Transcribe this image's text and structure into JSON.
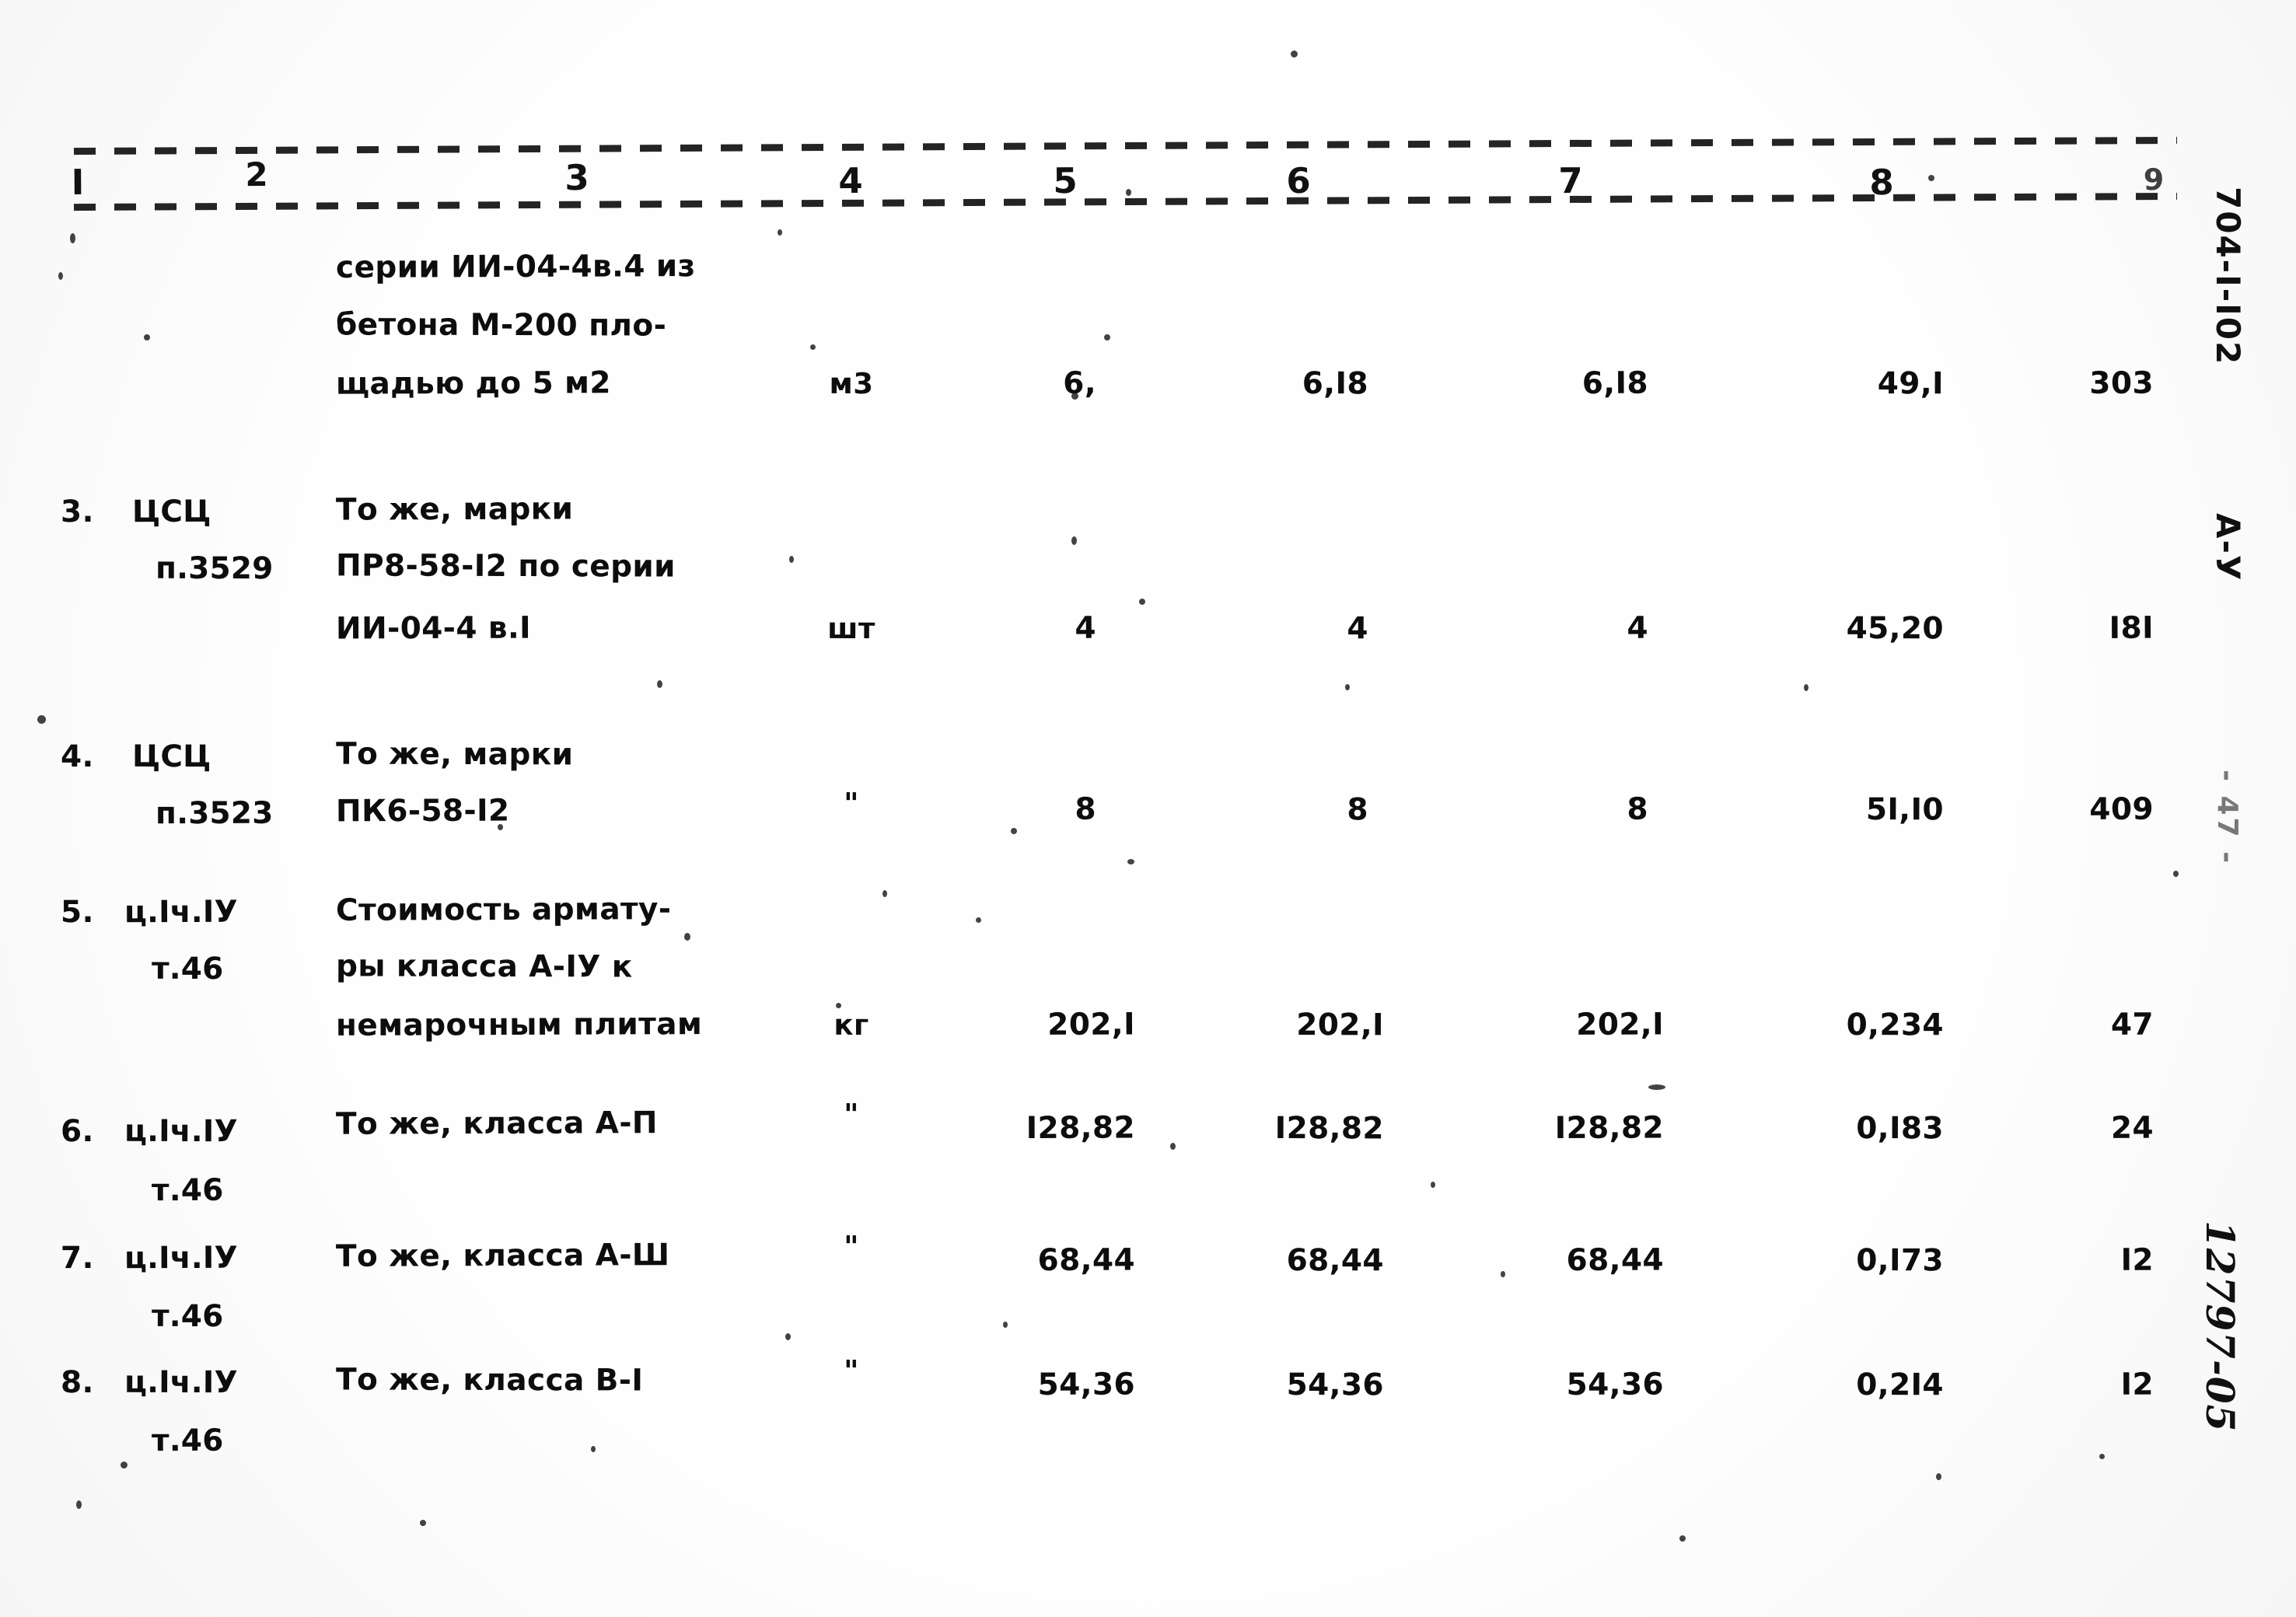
{
  "document": {
    "column_headers": [
      "I",
      "2",
      "3",
      "4",
      "5",
      "6",
      "7",
      "8",
      "9"
    ],
    "margin": {
      "document_code": "704-I-I02",
      "section_code": "А-У",
      "page_number": "- 47 -",
      "archive_number": "12797-05"
    },
    "rows": [
      {
        "index": "",
        "code": "",
        "description_lines": [
          "серии ИИ-04-4в.4 из",
          "бетона М-200 пло-",
          "щадью до 5 м2"
        ],
        "unit": "м3",
        "col5": "6,",
        "col6": "6,I8",
        "col7": "6,I8",
        "col8": "49,I",
        "col9": "303"
      },
      {
        "index": "3.",
        "code": "ЦСЦ",
        "code2": "п.3529",
        "description_lines": [
          "То же, марки",
          "ПР8-58-I2 по серии",
          "ИИ-04-4 в.I"
        ],
        "unit": "шт",
        "col5": "4",
        "col6": "4",
        "col7": "4",
        "col8": "45,20",
        "col9": "I8I"
      },
      {
        "index": "4.",
        "code": "ЦСЦ",
        "code2": "п.3523",
        "description_lines": [
          "То же, марки",
          "ПК6-58-I2"
        ],
        "unit": "\"",
        "col5": "8",
        "col6": "8",
        "col7": "8",
        "col8": "5I,I0",
        "col9": "409"
      },
      {
        "index": "5.",
        "code": "ц.Iч.IУ",
        "code2": "т.46",
        "description_lines": [
          "Стоимость армату-",
          "ры класса А-IУ к",
          "немарочным плитам"
        ],
        "unit": "кг",
        "col5": "202,I",
        "col6": "202,I",
        "col7": "202,I",
        "col8": "0,234",
        "col9": "47"
      },
      {
        "index": "6.",
        "code": "ц.Iч.IУ",
        "code2": "т.46",
        "description_lines": [
          "То же, класса А-П"
        ],
        "unit": "\"",
        "col5": "I28,82",
        "col6": "I28,82",
        "col7": "I28,82",
        "col8": "0,I83",
        "col9": "24"
      },
      {
        "index": "7.",
        "code": "ц.Iч.IУ",
        "code2": "т.46",
        "description_lines": [
          "То же, класса А-Ш"
        ],
        "unit": "\"",
        "col5": "68,44",
        "col6": "68,44",
        "col7": "68,44",
        "col8": "0,I73",
        "col9": "I2"
      },
      {
        "index": "8.",
        "code": "ц.Iч.IУ",
        "code2": "т.46",
        "description_lines": [
          "То же, класса В-I"
        ],
        "unit": "\"",
        "col5": "54,36",
        "col6": "54,36",
        "col7": "54,36",
        "col8": "0,2I4",
        "col9": "I2"
      }
    ]
  }
}
